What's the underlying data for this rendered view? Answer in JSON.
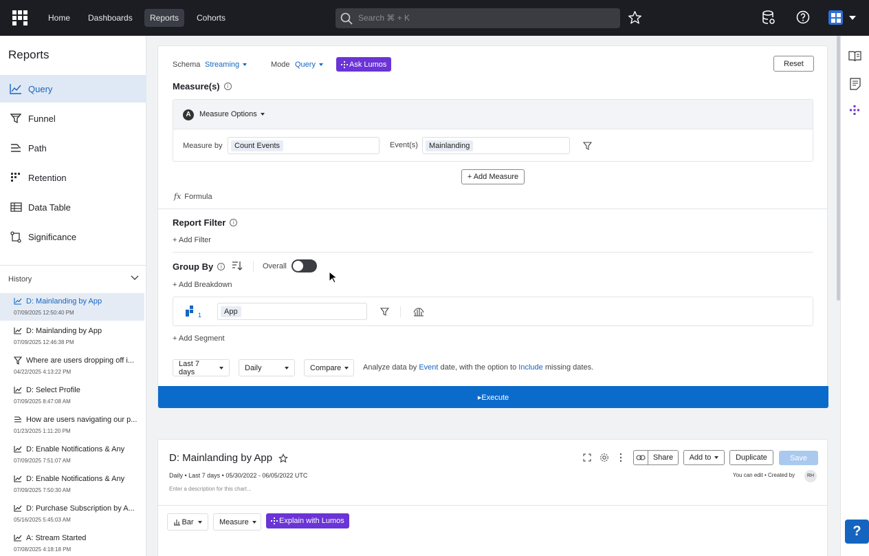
{
  "nav": {
    "links": [
      "Home",
      "Dashboards",
      "Reports",
      "Cohorts"
    ],
    "active": "Reports",
    "search_placeholder": "Search ⌘ + K"
  },
  "sidebar": {
    "title": "Reports",
    "items": [
      {
        "label": "Query",
        "icon": "line-chart-icon"
      },
      {
        "label": "Funnel",
        "icon": "funnel-icon"
      },
      {
        "label": "Path",
        "icon": "path-icon"
      },
      {
        "label": "Retention",
        "icon": "retention-icon"
      },
      {
        "label": "Data Table",
        "icon": "table-icon"
      },
      {
        "label": "Significance",
        "icon": "significance-icon"
      }
    ],
    "history_label": "History",
    "history": [
      {
        "title": "D: Mainlanding by App",
        "date": "07/09/2025 12:50:40 PM",
        "icon": "line-chart-icon"
      },
      {
        "title": "D: Mainlanding by App",
        "date": "07/09/2025 12:46:38 PM",
        "icon": "line-chart-icon"
      },
      {
        "title": "Where are users dropping off i...",
        "date": "04/22/2025 4:13:22 PM",
        "icon": "funnel-icon"
      },
      {
        "title": "D: Select Profile",
        "date": "07/09/2025 8:47:08 AM",
        "icon": "line-chart-icon"
      },
      {
        "title": "How are users navigating our p...",
        "date": "01/23/2025 1:11:20 PM",
        "icon": "path-icon"
      },
      {
        "title": "D: Enable Notifications & Any",
        "date": "07/09/2025 7:51:07 AM",
        "icon": "line-chart-icon"
      },
      {
        "title": "D: Enable Notifications & Any",
        "date": "07/09/2025 7:50:30 AM",
        "icon": "line-chart-icon"
      },
      {
        "title": "D: Purchase Subscription by A...",
        "date": "05/16/2025 5:45:03 AM",
        "icon": "line-chart-icon"
      },
      {
        "title": "A: Stream Started",
        "date": "07/08/2025 4:18:18 PM",
        "icon": "line-chart-icon"
      }
    ]
  },
  "query": {
    "schema_label": "Schema",
    "schema_value": "Streaming",
    "mode_label": "Mode",
    "mode_value": "Query",
    "ask_lumos": "Ask Lumos",
    "reset": "Reset",
    "measures_title": "Measure(s)",
    "measure_badge": "A",
    "measure_options": "Measure Options",
    "measure_by_label": "Measure by",
    "measure_by_value": "Count Events",
    "events_label": "Event(s)",
    "events_value": "Mainlanding",
    "add_measure": "+ Add Measure",
    "formula": "Formula",
    "report_filter_title": "Report Filter",
    "add_filter": "+ Add Filter",
    "group_by_title": "Group By",
    "overall_label": "Overall",
    "add_breakdown": "+ Add Breakdown",
    "segment_number": "1",
    "segment_value": "App",
    "add_segment": "+ Add Segment",
    "date_range": "Last 7 days",
    "interval": "Daily",
    "compare": "Compare",
    "analyze_text_1": "Analyze data by",
    "analyze_event": "Event",
    "analyze_text_2": "date, with the option to",
    "analyze_include": "Include",
    "analyze_text_3": "missing dates.",
    "execute": "▸Execute"
  },
  "chart": {
    "title": "D: Mainlanding by App",
    "meta": "Daily • Last 7 days • 05/30/2022 - 06/05/2022 UTC",
    "description_placeholder": "Enter a description for this chart...",
    "share": "Share",
    "add_to": "Add to",
    "duplicate": "Duplicate",
    "save": "Save",
    "can_edit": "You can edit • Created by",
    "avatar_initials": "RH",
    "chart_type": "Bar",
    "measure_select": "Measure",
    "explain_lumos": "Explain with Lumos"
  },
  "colors": {
    "accent": "#1565c0",
    "lumos": "#6a34d6",
    "execute": "#0b6bcb",
    "nav_bg": "#1b1d23"
  }
}
